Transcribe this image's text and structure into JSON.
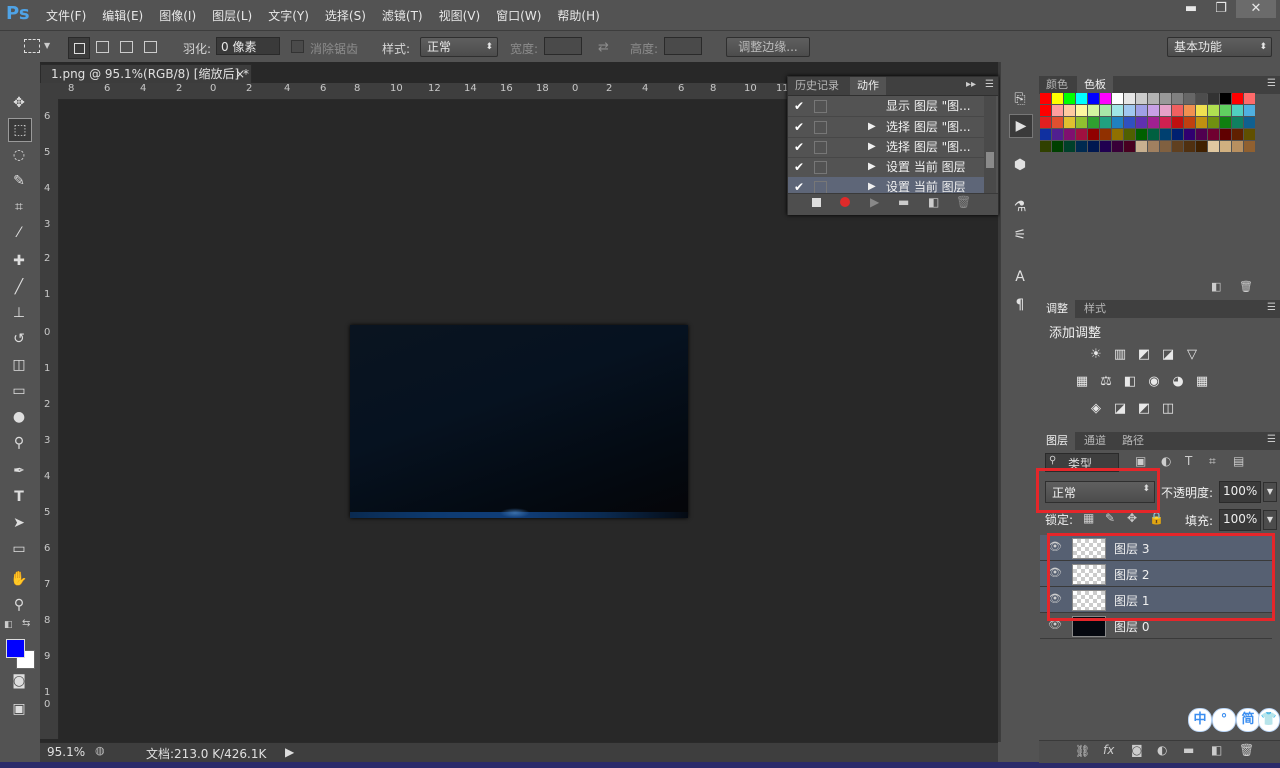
{
  "app": {
    "logo": "Ps"
  },
  "menu": [
    "文件(F)",
    "编辑(E)",
    "图像(I)",
    "图层(L)",
    "文字(Y)",
    "选择(S)",
    "滤镜(T)",
    "视图(V)",
    "窗口(W)",
    "帮助(H)"
  ],
  "window_controls": {
    "minimize": "▬",
    "restore": "❐",
    "close": "✕"
  },
  "options": {
    "feather_label": "羽化:",
    "feather_value": "0 像素",
    "antialias_label": "消除锯齿",
    "style_label": "样式:",
    "style_value": "正常",
    "width_label": "宽度:",
    "height_label": "高度:",
    "refine_button": "调整边缘...",
    "workspace": "基本功能"
  },
  "document": {
    "tab_title": "1.png @ 95.1%(RGB/8) [缩放后] *",
    "tab_close": "×",
    "ruler_top": [
      "8",
      "6",
      "4",
      "2",
      "0",
      "2",
      "4",
      "6",
      "8",
      "10",
      "12",
      "14",
      "16",
      "18",
      "0",
      "2",
      "4",
      "6",
      "8",
      "10",
      "11"
    ],
    "ruler_left": [
      "6",
      "5",
      "4",
      "3",
      "2",
      "1",
      "0",
      "1",
      "2",
      "3",
      "4",
      "5",
      "6",
      "7",
      "8",
      "9",
      "1",
      "0"
    ]
  },
  "status": {
    "zoom": "95.1%",
    "doc_info": "文档:213.0 K/426.1K"
  },
  "actions_panel": {
    "tabs": [
      "历史记录",
      "动作"
    ],
    "rows": [
      {
        "label": "显示 图层 \"图...",
        "has_arrow": false
      },
      {
        "label": "选择 图层 \"图...",
        "has_arrow": true
      },
      {
        "label": "选择 图层 \"图...",
        "has_arrow": true
      },
      {
        "label": "设置 当前 图层",
        "has_arrow": true
      },
      {
        "label": "设置 当前 图层",
        "has_arrow": true
      }
    ]
  },
  "swatches_panel": {
    "tabs": [
      "颜色",
      "色板"
    ],
    "colors": [
      "#ff0000",
      "#ffff00",
      "#00ff00",
      "#00ffff",
      "#0000ff",
      "#ff00ff",
      "#ffffff",
      "#e6e6e6",
      "#cccccc",
      "#b3b3b3",
      "#999999",
      "#808080",
      "#666666",
      "#4d4d4d",
      "#333333",
      "#000000",
      "#ff0000",
      "#ff6a6a",
      "#ff0000",
      "#ff9e9e",
      "#ffcaa0",
      "#fff6a0",
      "#d4f4a0",
      "#a8e6a8",
      "#a0e6e6",
      "#a0c8f0",
      "#a0a0e6",
      "#c8a0e6",
      "#e6a0c8",
      "#f06060",
      "#f09050",
      "#f0e050",
      "#b0e050",
      "#60d060",
      "#50d0c0",
      "#50b0e0",
      "#e02020",
      "#e05030",
      "#e0c030",
      "#90c030",
      "#30a030",
      "#20a080",
      "#2080c0",
      "#3050c0",
      "#6030b0",
      "#a02090",
      "#d02050",
      "#c01010",
      "#c04010",
      "#c09010",
      "#709010",
      "#108010",
      "#108060",
      "#106090",
      "#1030a0",
      "#502090",
      "#801070",
      "#a01040",
      "#900000",
      "#903000",
      "#907000",
      "#506000",
      "#006000",
      "#006040",
      "#004070",
      "#002070",
      "#300070",
      "#500050",
      "#700030",
      "#600000",
      "#602000",
      "#605000",
      "#304000",
      "#004000",
      "#00402a",
      "#002a50",
      "#001850",
      "#200050",
      "#380038",
      "#480020",
      "#c8b090",
      "#a08060",
      "#806040",
      "#604020",
      "#503010",
      "#402000",
      "#e0c8a0",
      "#d0b080",
      "#b89060",
      "#906030"
    ]
  },
  "adjustments_panel": {
    "tabs": [
      "调整",
      "样式"
    ],
    "title": "添加调整",
    "row1": [
      "☀",
      "▥",
      "◩",
      "◪",
      "▽"
    ],
    "row2": [
      "▦",
      "⚖",
      "◧",
      "◉",
      "◕",
      "▦"
    ],
    "row3": [
      "◈",
      "◪",
      "◩",
      "◫"
    ]
  },
  "layers_panel": {
    "tabs": [
      "图层",
      "通道",
      "路径"
    ],
    "kind_filter": "类型",
    "blend_mode": "正常",
    "opacity_label": "不透明度:",
    "opacity_value": "100%",
    "lock_label": "锁定:",
    "fill_label": "填充:",
    "fill_value": "100%",
    "layers": [
      {
        "name": "图层 3",
        "selected": true
      },
      {
        "name": "图层 2",
        "selected": true
      },
      {
        "name": "图层 1",
        "selected": true
      },
      {
        "name": "图层 0",
        "selected": false
      }
    ]
  },
  "ime": [
    "中",
    "°",
    "简",
    "👕"
  ],
  "highlight_color": "#e5262a",
  "selection_color": "#566072"
}
